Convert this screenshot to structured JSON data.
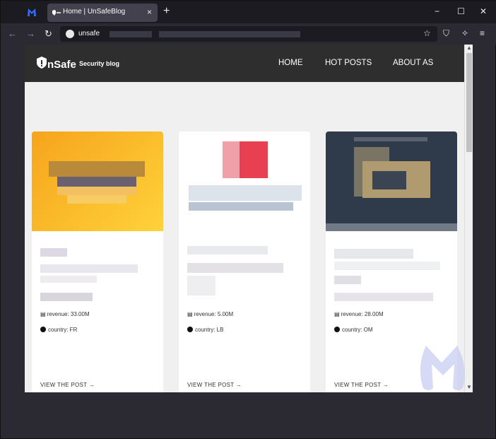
{
  "browser": {
    "tab_title": "Home | UnSafeBlog",
    "tab_close": "×",
    "new_tab": "+",
    "url": "unsafe",
    "nav": {
      "back": "←",
      "forward": "→",
      "reload": "↻"
    },
    "window_controls": {
      "minimize": "−",
      "maximize": "☐",
      "close": "✕"
    },
    "tools": {
      "bookmark": "☆",
      "shield": "⛉",
      "extensions": "✧",
      "menu": "≡"
    }
  },
  "site": {
    "brand_name": "nSafe",
    "brand_tagline": "Security blog",
    "nav": [
      "HOME",
      "HOT POSTS",
      "ABOUT AS"
    ]
  },
  "posts": [
    {
      "revenue": "revenue: 33.00M",
      "country": "country: FR",
      "view": "VIEW THE POST →"
    },
    {
      "revenue": "revenue: 5.00M",
      "country": "country: LB",
      "view": "VIEW THE POST →"
    },
    {
      "revenue": "revenue: 28.00M",
      "country": "country: OM",
      "view": "VIEW THE POST →"
    }
  ],
  "scroll": {
    "up": "▲",
    "down": "▼"
  },
  "colors": {
    "accent": "#ffc420",
    "header": "#2e2e2e",
    "watermark": "#c8cdf0"
  }
}
